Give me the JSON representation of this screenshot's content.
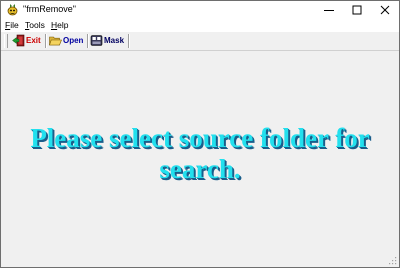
{
  "window": {
    "title": "\"frmRemove\"",
    "app_icon": "app-icon",
    "controls": [
      "minimize-icon",
      "maximize-icon",
      "close-icon"
    ]
  },
  "menubar": {
    "items": [
      {
        "label_underlined": "F",
        "label_rest": "ile"
      },
      {
        "label_underlined": "T",
        "label_rest": "ools"
      },
      {
        "label_underlined": "H",
        "label_rest": "elp"
      }
    ]
  },
  "toolbar": {
    "buttons": [
      {
        "label": "Exit",
        "icon": "exit-icon",
        "color": "#cc0000"
      },
      {
        "label": "Open",
        "icon": "open-folder-icon",
        "color": "#0000a0"
      },
      {
        "label": "Mask",
        "icon": "mask-icon",
        "color": "#000060"
      }
    ]
  },
  "main": {
    "message": "Please select source folder for search.",
    "message_color": "#22e0ee",
    "message_shadow_color": "#1a5d8a"
  }
}
